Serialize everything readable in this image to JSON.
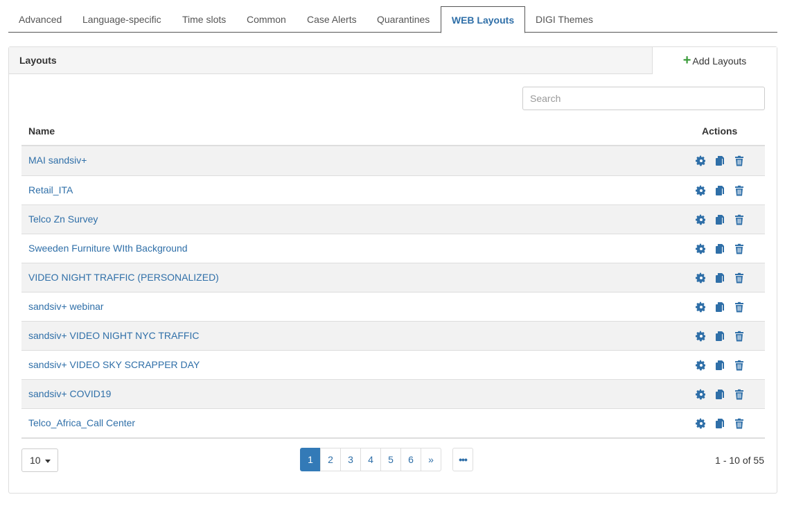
{
  "tabs": [
    {
      "label": "Advanced",
      "active": false
    },
    {
      "label": "Language-specific",
      "active": false
    },
    {
      "label": "Time slots",
      "active": false
    },
    {
      "label": "Common",
      "active": false
    },
    {
      "label": "Case Alerts",
      "active": false
    },
    {
      "label": "Quarantines",
      "active": false
    },
    {
      "label": "WEB Layouts",
      "active": true
    },
    {
      "label": "DIGI Themes",
      "active": false
    }
  ],
  "panel": {
    "title": "Layouts",
    "add_button": "Add Layouts",
    "add_icon": "plus-icon"
  },
  "search": {
    "placeholder": "Search",
    "value": ""
  },
  "table": {
    "columns": [
      "Name",
      "Actions"
    ],
    "rows": [
      "MAI sandsiv+",
      "Retail_ITA",
      "Telco Zn Survey",
      "Sweeden Furniture WIth Background",
      "VIDEO NIGHT TRAFFIC (PERSONALIZED)",
      "sandsiv+ webinar",
      "sandsiv+ VIDEO NIGHT NYC TRAFFIC",
      "sandsiv+ VIDEO SKY SCRAPPER DAY",
      "sandsiv+ COVID19",
      "Telco_Africa_Call Center"
    ],
    "row_actions": [
      "gear-icon",
      "copy-icon",
      "trash-icon"
    ]
  },
  "pagination": {
    "page_size": "10",
    "pages": [
      "1",
      "2",
      "3",
      "4",
      "5",
      "6",
      "»"
    ],
    "current_page": "1",
    "more": "•••",
    "range_text": "1 - 10 of 55"
  },
  "colors": {
    "link": "#2f6fa8",
    "active_page": "#337ab7",
    "add_plus": "#3c9c3c",
    "row_stripe": "#f2f2f2"
  }
}
